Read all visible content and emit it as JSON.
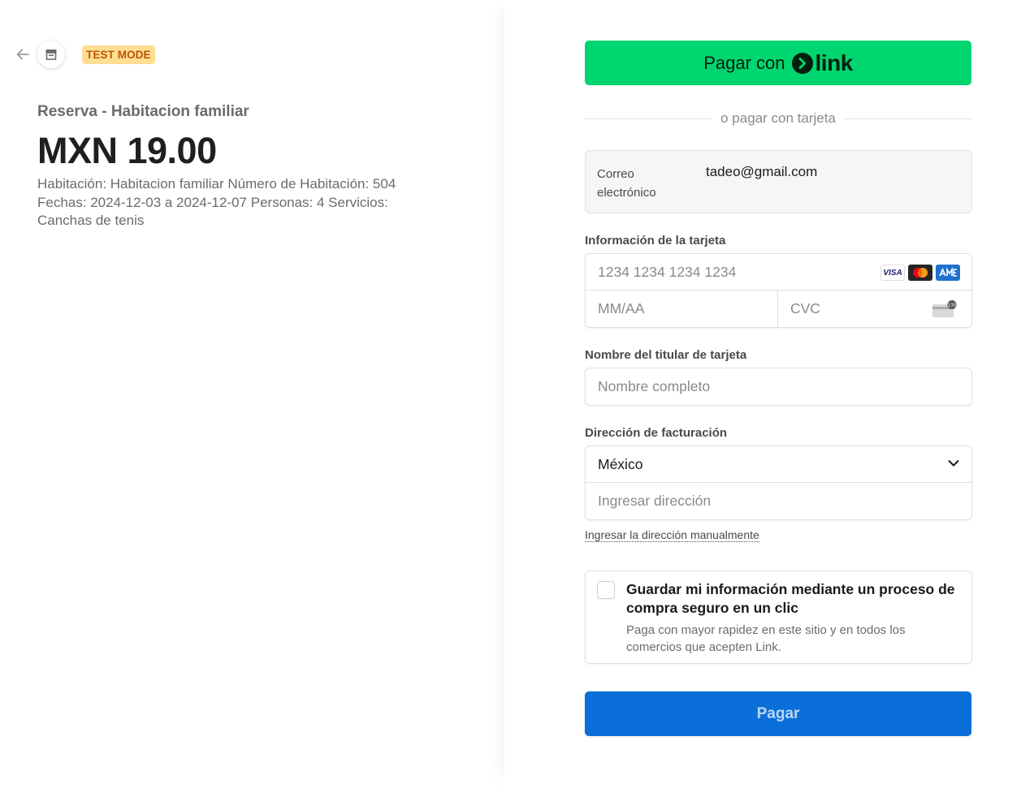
{
  "left": {
    "test_mode_badge": "TEST MODE",
    "product_name": "Reserva - Habitacion familiar",
    "price": "MXN 19.00",
    "description": "Habitación: Habitacion familiar Número de Habitación: 504 Fechas: 2024-12-03 a 2024-12-07 Personas: 4 Servicios: Canchas de tenis"
  },
  "link": {
    "pay_with": "Pagar con",
    "brand": "link",
    "color": "#00d66f"
  },
  "divider_text": "o pagar con tarjeta",
  "email": {
    "label": "Correo electrónico",
    "value": "tadeo@gmail.com"
  },
  "card": {
    "label": "Información de la tarjeta",
    "number_placeholder": "1234 1234 1234 1234",
    "expiry_placeholder": "MM/AA",
    "cvc_placeholder": "CVC",
    "brands": [
      "VISA",
      "mastercard",
      "amex"
    ],
    "cvc_icon_text": "135"
  },
  "cardholder": {
    "label": "Nombre del titular de tarjeta",
    "placeholder": "Nombre completo"
  },
  "billing": {
    "label": "Dirección de facturación",
    "country": "México",
    "address_placeholder": "Ingresar dirección",
    "manual_link": "Ingresar la dirección manualmente"
  },
  "save_info": {
    "title": "Guardar mi información mediante un proceso de compra seguro en un clic",
    "subtitle": "Paga con mayor rapidez en este sitio y en todos los comercios que acepten Link."
  },
  "pay_button": {
    "label": "Pagar",
    "color": "#0a6fd8"
  }
}
